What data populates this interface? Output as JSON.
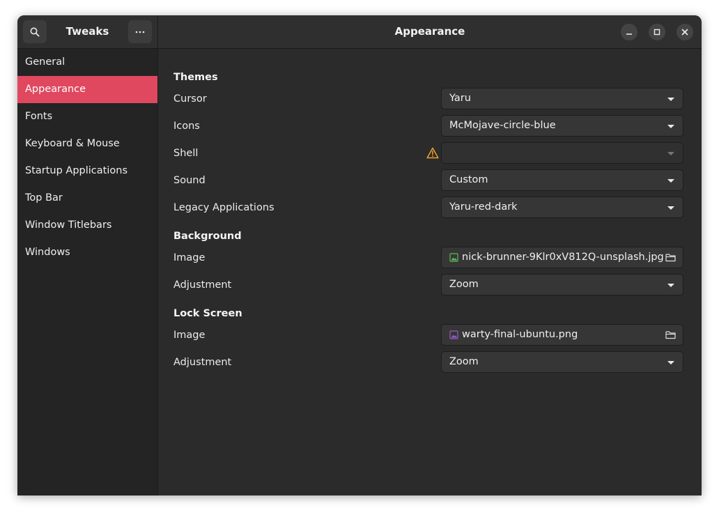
{
  "sidebar": {
    "title": "Tweaks",
    "items": [
      {
        "label": "General"
      },
      {
        "label": "Appearance"
      },
      {
        "label": "Fonts"
      },
      {
        "label": "Keyboard & Mouse"
      },
      {
        "label": "Startup Applications"
      },
      {
        "label": "Top Bar"
      },
      {
        "label": "Window Titlebars"
      },
      {
        "label": "Windows"
      }
    ],
    "active_item": "Appearance",
    "icons": {
      "search": "search-icon",
      "menu": "more-horizontal-icon"
    }
  },
  "header": {
    "title": "Appearance",
    "controls": {
      "minimize": "minimize-icon",
      "maximize": "maximize-icon",
      "close": "close-icon"
    }
  },
  "themes": {
    "title": "Themes",
    "cursor": {
      "label": "Cursor",
      "value": "Yaru"
    },
    "icons": {
      "label": "Icons",
      "value": "McMojave-circle-blue"
    },
    "shell": {
      "label": "Shell",
      "value": "",
      "warning_icon": "warning-icon"
    },
    "sound": {
      "label": "Sound",
      "value": "Custom"
    },
    "legacy": {
      "label": "Legacy Applications",
      "value": "Yaru-red-dark"
    }
  },
  "background": {
    "title": "Background",
    "image": {
      "label": "Image",
      "file": "nick-brunner-9Klr0xV812Q-unsplash.jpg"
    },
    "adjustment": {
      "label": "Adjustment",
      "value": "Zoom"
    }
  },
  "lockscreen": {
    "title": "Lock Screen",
    "image": {
      "label": "Image",
      "file": "warty-final-ubuntu.png"
    },
    "adjustment": {
      "label": "Adjustment",
      "value": "Zoom"
    }
  },
  "colors": {
    "accent": "#e0485f",
    "window_bg": "#2b2b2b",
    "sidebar_bg": "#242424",
    "warning": "#f0a030"
  }
}
